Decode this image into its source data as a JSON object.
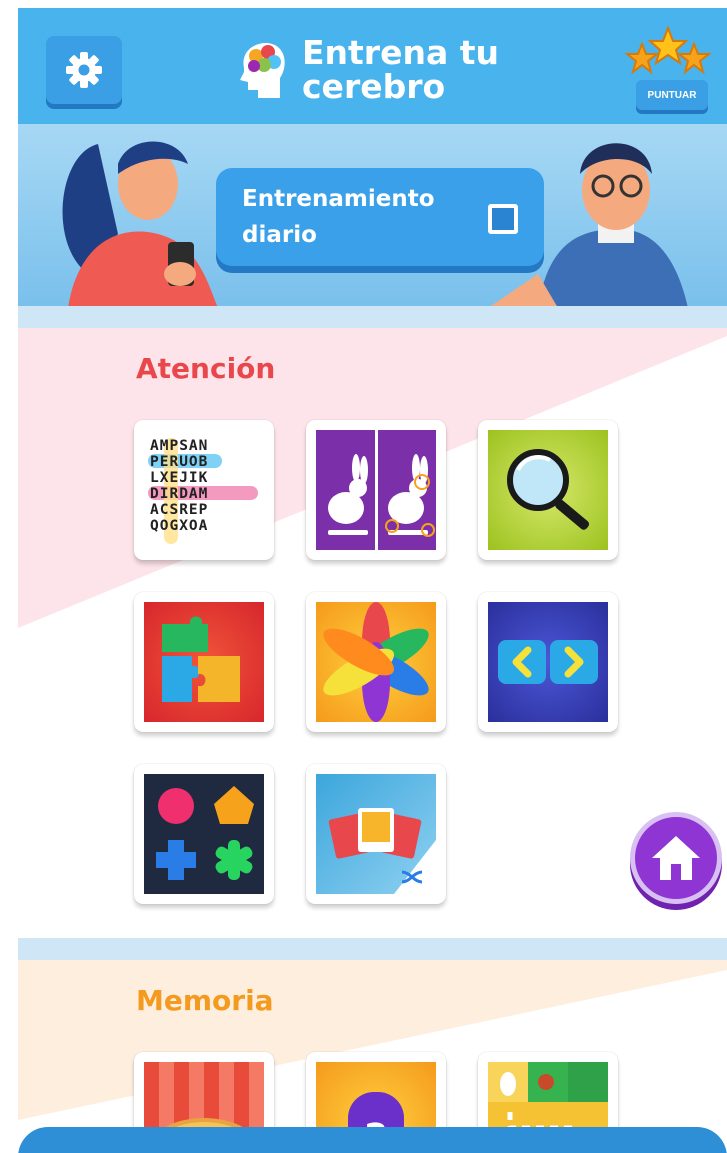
{
  "header": {
    "title_line1": "Entrena tu",
    "title_line2": "cerebro",
    "settings_icon": "gear-icon",
    "rate_label": "PUNTUAR",
    "rate_icon": "three-stars-icon"
  },
  "banner": {
    "daily_label": "Entrenamiento\ndiario",
    "daily_checked": false
  },
  "sections": [
    {
      "title": "Atención",
      "color": "#e8474b",
      "games": [
        {
          "name": "word-search",
          "letters": [
            "AMPSAN",
            "PERUOB",
            "LXEJIK",
            "DIRDAM",
            "ACSREP",
            "QOGXOA"
          ]
        },
        {
          "name": "spot-the-difference"
        },
        {
          "name": "find-with-magnifier"
        },
        {
          "name": "puzzle"
        },
        {
          "name": "color-splash"
        },
        {
          "name": "left-right-arrows"
        },
        {
          "name": "shapes-match"
        },
        {
          "name": "shuffle-pictures"
        }
      ]
    },
    {
      "title": "Memoria",
      "color": "#f39a1f",
      "games": [
        {
          "name": "pizza"
        },
        {
          "name": "mystery-card",
          "symbol": "?"
        },
        {
          "name": "path-grid"
        }
      ]
    }
  ],
  "home_icon": "home-icon",
  "colors": {
    "header": "#49b3ee",
    "accent_dark": "#2f8fd6",
    "home": "#8e35d4"
  }
}
